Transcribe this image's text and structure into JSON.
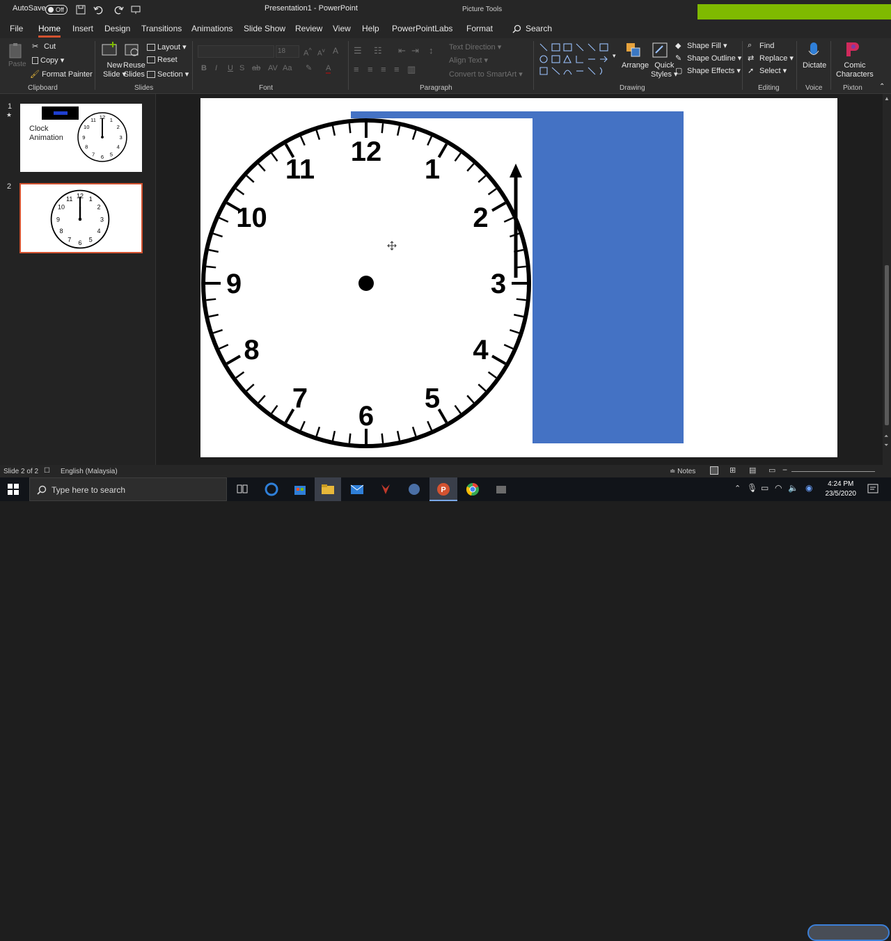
{
  "titlebar": {
    "autosave_label": "AutoSave",
    "autosave_state": "Off",
    "title": "Presentation1 - PowerPoint",
    "context_tab": "Picture Tools"
  },
  "tabs": [
    "File",
    "Home",
    "Insert",
    "Design",
    "Transitions",
    "Animations",
    "Slide Show",
    "Review",
    "View",
    "Help",
    "PowerPointLabs",
    "Format"
  ],
  "search_label": "Search",
  "ribbon": {
    "clipboard": {
      "paste": "Paste",
      "cut": "Cut",
      "copy": "Copy",
      "format_painter": "Format Painter",
      "group": "Clipboard"
    },
    "slides": {
      "new_slide_1": "New",
      "new_slide_2": "Slide",
      "reuse_1": "Reuse",
      "reuse_2": "Slides",
      "layout": "Layout",
      "reset": "Reset",
      "section": "Section",
      "group": "Slides"
    },
    "font": {
      "size": "18",
      "group": "Font"
    },
    "paragraph": {
      "text_direction": "Text Direction",
      "align_text": "Align Text",
      "convert": "Convert to SmartArt",
      "group": "Paragraph"
    },
    "drawing": {
      "arrange": "Arrange",
      "quick_styles_1": "Quick",
      "quick_styles_2": "Styles",
      "shape_fill": "Shape Fill",
      "shape_outline": "Shape Outline",
      "shape_effects": "Shape Effects",
      "group": "Drawing"
    },
    "editing": {
      "find": "Find",
      "replace": "Replace",
      "select": "Select",
      "group": "Editing"
    },
    "voice": {
      "dictate": "Dictate",
      "group": "Voice"
    },
    "pixton": {
      "comic_1": "Comic",
      "comic_2": "Characters",
      "group": "Pixton"
    }
  },
  "thumbnails": [
    {
      "number": "1",
      "star": "★",
      "title_text": "Clock Animation"
    },
    {
      "number": "2"
    }
  ],
  "clock_numbers": [
    "12",
    "1",
    "2",
    "3",
    "4",
    "5",
    "6",
    "7",
    "8",
    "9",
    "10",
    "11"
  ],
  "status": {
    "slide": "Slide 2 of 2",
    "language": "English (Malaysia)",
    "notes": "Notes"
  },
  "taskbar": {
    "search_placeholder": "Type here to search",
    "time": "4:24 PM",
    "date": "23/5/2020"
  },
  "colors": {
    "accent": "#d35230",
    "blue_rect": "#4472c4",
    "green_block": "#7fba00"
  }
}
